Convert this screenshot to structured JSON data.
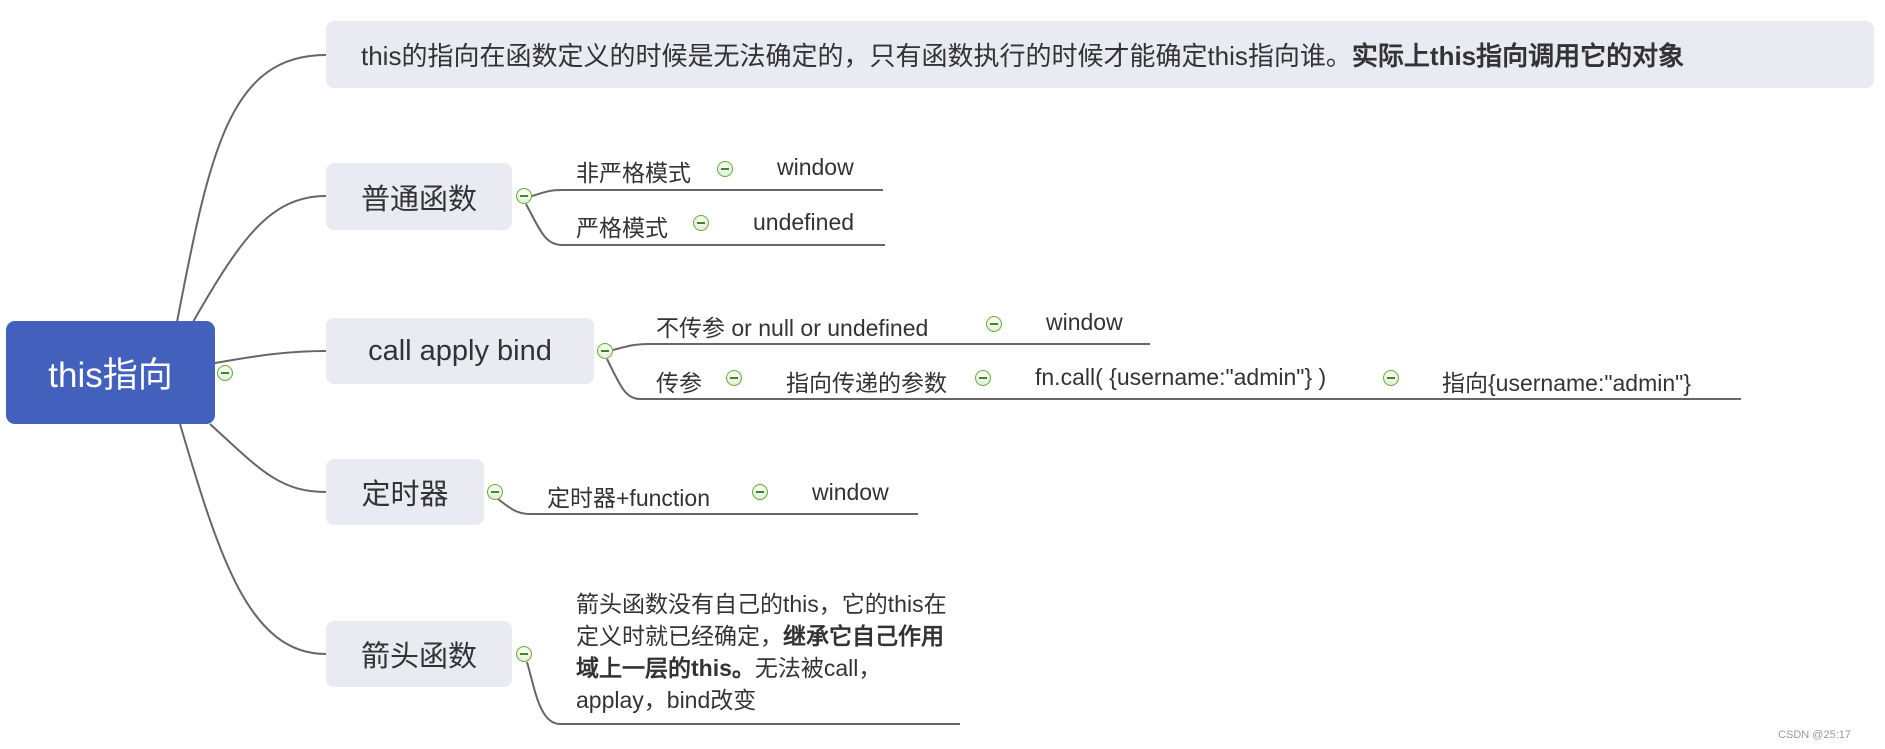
{
  "root": {
    "label": "this指向"
  },
  "summary": {
    "text": "this的指向在函数定义的时候是无法确定的，只有函数执行的时候才能确定this指向谁。",
    "bold": "实际上this指向调用它的对象"
  },
  "branches": [
    {
      "label": "普通函数",
      "children": [
        {
          "label": "非严格模式",
          "result": "window"
        },
        {
          "label": "严格模式",
          "result": "undefined"
        }
      ]
    },
    {
      "label": "call apply bind",
      "children": [
        {
          "label": "不传参 or null or undefined",
          "result": "window"
        },
        {
          "label": "传参",
          "step1": "指向传递的参数",
          "step2": "fn.call( {username:\"admin\"} )",
          "result": "指向{username:\"admin\"}"
        }
      ]
    },
    {
      "label": "定时器",
      "children": [
        {
          "label": "定时器+function",
          "result": "window"
        }
      ]
    },
    {
      "label": "箭头函数",
      "note": {
        "part1": "箭头函数没有自己的this，它的this在定义时就已经确定，",
        "bold": "继承它自己作用域上一层的this。",
        "part2": "无法被call，applay，bind改变"
      }
    }
  ],
  "colors": {
    "root": "#4360BC",
    "topic_bg": "#E9EAF2",
    "line": "#666666",
    "collapse": "#6DAA3A"
  },
  "watermark": "CSDN @25:17"
}
